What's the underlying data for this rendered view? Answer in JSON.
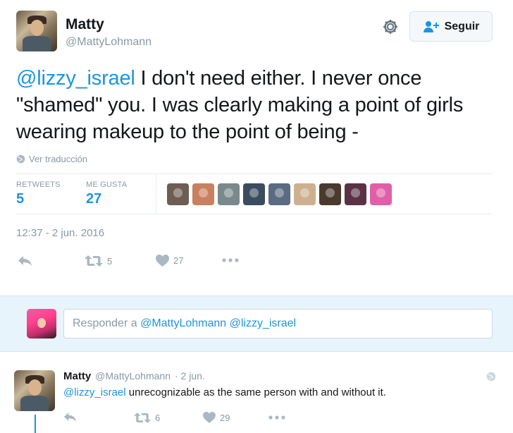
{
  "tweet": {
    "author_name": "Matty",
    "author_handle": "@MattyLohmann",
    "follow_label": "Seguir",
    "text_mention": "@lizzy_israel",
    "text_body": " I don't need either. I never once \"shamed\" you. I was clearly making a point of girls wearing makeup to the point of being -",
    "translate_label": "Ver traducción",
    "stats": {
      "retweets_label": "RETWEETS",
      "retweets_value": "5",
      "likes_label": "ME GUSTA",
      "likes_value": "27"
    },
    "liker_colors": [
      "#6e5d52",
      "#c98060",
      "#7a8a8c",
      "#3b4c5e",
      "#5a6b82",
      "#cdb08f",
      "#4a3a2e",
      "#5b3245",
      "#e060a8"
    ],
    "timestamp": "12:37 - 2 jun. 2016",
    "actions": {
      "retweet_count": "5",
      "like_count": "27"
    }
  },
  "reply_box": {
    "placeholder_prefix": "Responder a ",
    "mentions": "@MattyLohmann @lizzy_israel"
  },
  "reply_tweet": {
    "author_name": "Matty",
    "author_handle": "@MattyLohmann",
    "time": "· 2 jun.",
    "text_mention": "@lizzy_israel",
    "text_body": " unrecognizable as the same person with and without it.",
    "retweet_count": "6",
    "like_count": "29"
  },
  "icons": {
    "gear": "gear-icon",
    "follow": "add-user-icon",
    "globe": "globe-icon",
    "reply": "reply-icon",
    "retweet": "retweet-icon",
    "like": "heart-icon",
    "more": "more-icon"
  },
  "colors": {
    "accent": "#1b95e0",
    "muted": "#8899a6",
    "reply_bg": "#e8f4fb"
  }
}
